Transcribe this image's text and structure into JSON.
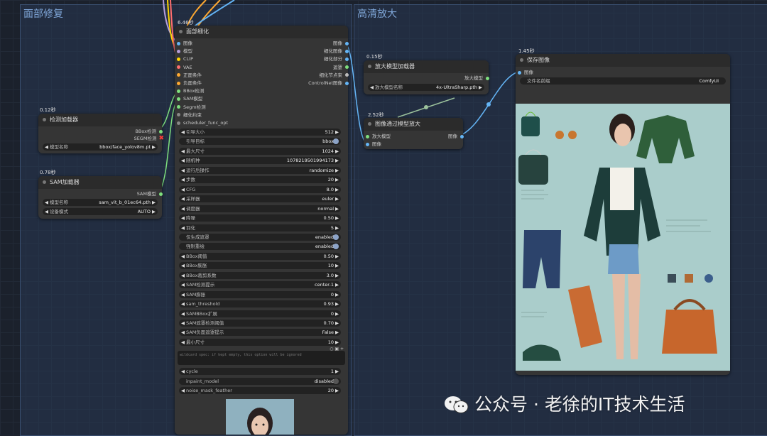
{
  "groups": {
    "face_detailer_group": "面部修复",
    "upscale_group": "高清放大"
  },
  "face_detailer": {
    "timing": "6.46秒",
    "title": "面部细化",
    "inputs": [
      "图像",
      "模型",
      "CLIP",
      "VAE",
      "正面条件",
      "负面条件",
      "BBox检测",
      "SAM模型",
      "Segm检测",
      "细化约束",
      "scheduler_func_opt"
    ],
    "outputs": [
      "图像",
      "细化图像",
      "细化部分",
      "遮罩",
      "细化节点束",
      "ControlNet图像"
    ],
    "widgets": [
      {
        "label": "引导大小",
        "value": "512",
        "kind": "num"
      },
      {
        "label": "引导目标",
        "value": "bbox",
        "kind": "combo"
      },
      {
        "label": "最大尺寸",
        "value": "1024",
        "kind": "num"
      },
      {
        "label": "随机种",
        "value": "1078219501994173",
        "kind": "num"
      },
      {
        "label": "运行后操作",
        "value": "randomize",
        "kind": "num"
      },
      {
        "label": "步数",
        "value": "20",
        "kind": "num"
      },
      {
        "label": "CFG",
        "value": "8.0",
        "kind": "num"
      },
      {
        "label": "采样器",
        "value": "euler",
        "kind": "num"
      },
      {
        "label": "调度器",
        "value": "normal",
        "kind": "num"
      },
      {
        "label": "降噪",
        "value": "0.50",
        "kind": "num"
      },
      {
        "label": "羽化",
        "value": "5",
        "kind": "num"
      },
      {
        "label": "仅生成遮罩",
        "value": "enabled",
        "kind": "toggle"
      },
      {
        "label": "强制重绘",
        "value": "enabled",
        "kind": "toggle"
      },
      {
        "label": "BBox阈值",
        "value": "0.50",
        "kind": "num"
      },
      {
        "label": "BBox膨胀",
        "value": "10",
        "kind": "num"
      },
      {
        "label": "BBox裁剪系数",
        "value": "3.0",
        "kind": "num"
      },
      {
        "label": "SAM检测提示",
        "value": "center-1",
        "kind": "num"
      },
      {
        "label": "SAM膨胀",
        "value": "0",
        "kind": "num"
      },
      {
        "label": "sam_threshold",
        "value": "0.93",
        "kind": "num"
      },
      {
        "label": "SAMBBox扩展",
        "value": "0",
        "kind": "num"
      },
      {
        "label": "SAM遮罩检测阈值",
        "value": "0.70",
        "kind": "num"
      },
      {
        "label": "SAM负面遮罩提示",
        "value": "False",
        "kind": "num"
      },
      {
        "label": "最小尺寸",
        "value": "10",
        "kind": "num"
      }
    ],
    "textarea_hint": "wildcard spec: if kept empty, this option will be ignored",
    "widgets2": [
      {
        "label": "cycle",
        "value": "1",
        "kind": "num"
      },
      {
        "label": "inpaint_model",
        "value": "disabled",
        "kind": "toggle-off"
      },
      {
        "label": "noise_mask_feather",
        "value": "20",
        "kind": "num"
      }
    ]
  },
  "detector_loader": {
    "timing": "0.12秒",
    "title": "检测加载器",
    "outputs": [
      "BBox检测",
      "SEGM检测"
    ],
    "widget": {
      "label": "模型名称",
      "value": "bbox/face_yolov8m.pt"
    }
  },
  "sam_loader": {
    "timing": "0.78秒",
    "title": "SAM加载器",
    "outputs": [
      "SAM模型"
    ],
    "widgets": [
      {
        "label": "模型名称",
        "value": "sam_vit_b_01ec64.pth"
      },
      {
        "label": "设备模式",
        "value": "AUTO"
      }
    ]
  },
  "upscale_loader": {
    "timing": "0.15秒",
    "title": "放大模型加载器",
    "outputs": [
      "放大模型"
    ],
    "widget": {
      "label": "放大模型名称",
      "value": "4x-UltraSharp.pth"
    }
  },
  "upscale_with_model": {
    "timing": "2.52秒",
    "title": "图像通过模型放大",
    "inputs": [
      "放大模型",
      "图像"
    ],
    "outputs": [
      "图像"
    ]
  },
  "save_image": {
    "timing": "1.45秒",
    "title": "保存图像",
    "inputs": [
      "图像"
    ],
    "widget": {
      "label": "文件名前缀",
      "value": "ComfyUI"
    }
  },
  "watermark": "公众号 · 老徐的IT技术生活",
  "colors": {
    "image_port": "#64b5f6",
    "model_port": "#b39ddb",
    "clip_port": "#ffd500",
    "vae_port": "#ff6e6e",
    "cond_port": "#ffa931",
    "detector_port": "#7ee07e",
    "error_mark": "#ff3b3b"
  }
}
